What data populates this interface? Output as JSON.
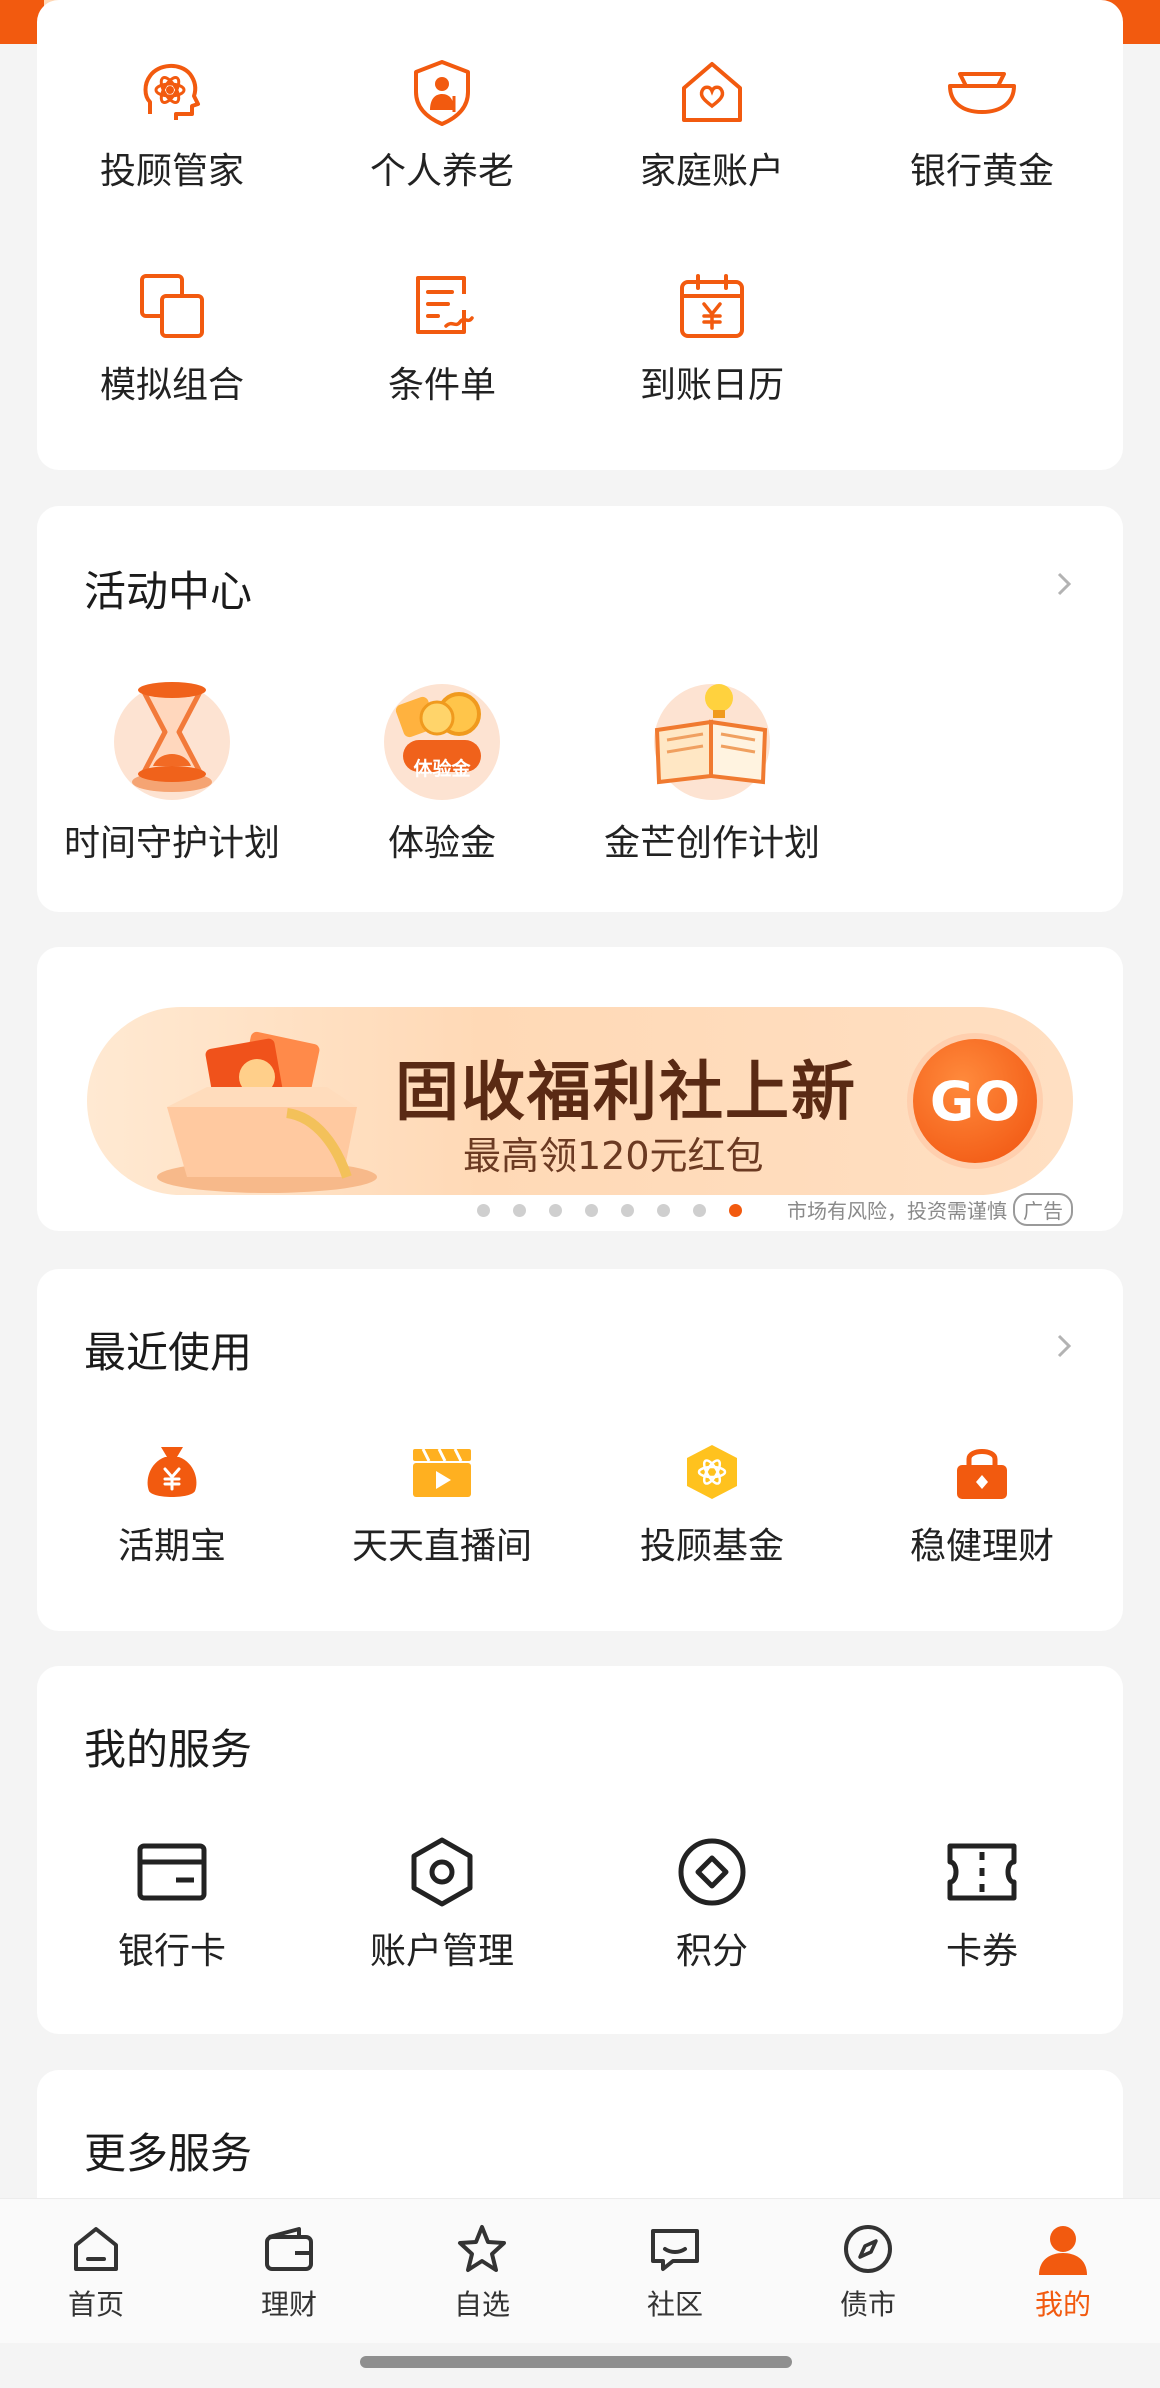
{
  "colors": {
    "accent": "#f25a0f",
    "page_bg": "#f4f4f4",
    "card_bg": "#ffffff"
  },
  "tools": {
    "items": [
      {
        "label": "投顾管家",
        "icon": "advisor-head-icon"
      },
      {
        "label": "个人养老",
        "icon": "pension-shield-icon"
      },
      {
        "label": "家庭账户",
        "icon": "family-house-icon"
      },
      {
        "label": "银行黄金",
        "icon": "gold-ingot-icon"
      },
      {
        "label": "模拟组合",
        "icon": "simulate-portfolio-icon"
      },
      {
        "label": "条件单",
        "icon": "condition-order-icon"
      },
      {
        "label": "到账日历",
        "icon": "calendar-yuan-icon"
      }
    ]
  },
  "activity": {
    "title": "活动中心",
    "items": [
      {
        "label": "时间守护计划",
        "icon": "hourglass-icon"
      },
      {
        "label": "体验金",
        "icon": "trial-gold-icon",
        "badge": "体验金"
      },
      {
        "label": "金芒创作计划",
        "icon": "book-bulb-icon"
      }
    ]
  },
  "banner": {
    "title": "固收福利社上新",
    "subtitle": "最高领120元红包",
    "go": "GO",
    "risk_note": "市场有风险，投资需谨慎",
    "ad_tag": "广告",
    "dots_total": 8,
    "dots_active_index": 7
  },
  "recent": {
    "title": "最近使用",
    "items": [
      {
        "label": "活期宝",
        "icon": "money-bag-icon"
      },
      {
        "label": "天天直播间",
        "icon": "live-clapper-icon"
      },
      {
        "label": "投顾基金",
        "icon": "hex-atom-icon"
      },
      {
        "label": "稳健理财",
        "icon": "lock-icon"
      }
    ]
  },
  "my_services": {
    "title": "我的服务",
    "items": [
      {
        "label": "银行卡",
        "icon": "bank-card-icon"
      },
      {
        "label": "账户管理",
        "icon": "account-hex-icon"
      },
      {
        "label": "积分",
        "icon": "points-diamond-icon"
      },
      {
        "label": "卡券",
        "icon": "coupon-ticket-icon"
      }
    ]
  },
  "more_services": {
    "title": "更多服务"
  },
  "tabbar": {
    "tabs": [
      {
        "label": "首页",
        "icon": "home-icon"
      },
      {
        "label": "理财",
        "icon": "wallet-icon"
      },
      {
        "label": "自选",
        "icon": "star-icon"
      },
      {
        "label": "社区",
        "icon": "chat-icon"
      },
      {
        "label": "债市",
        "icon": "compass-icon"
      },
      {
        "label": "我的",
        "icon": "person-icon"
      }
    ],
    "active_index": 5
  }
}
